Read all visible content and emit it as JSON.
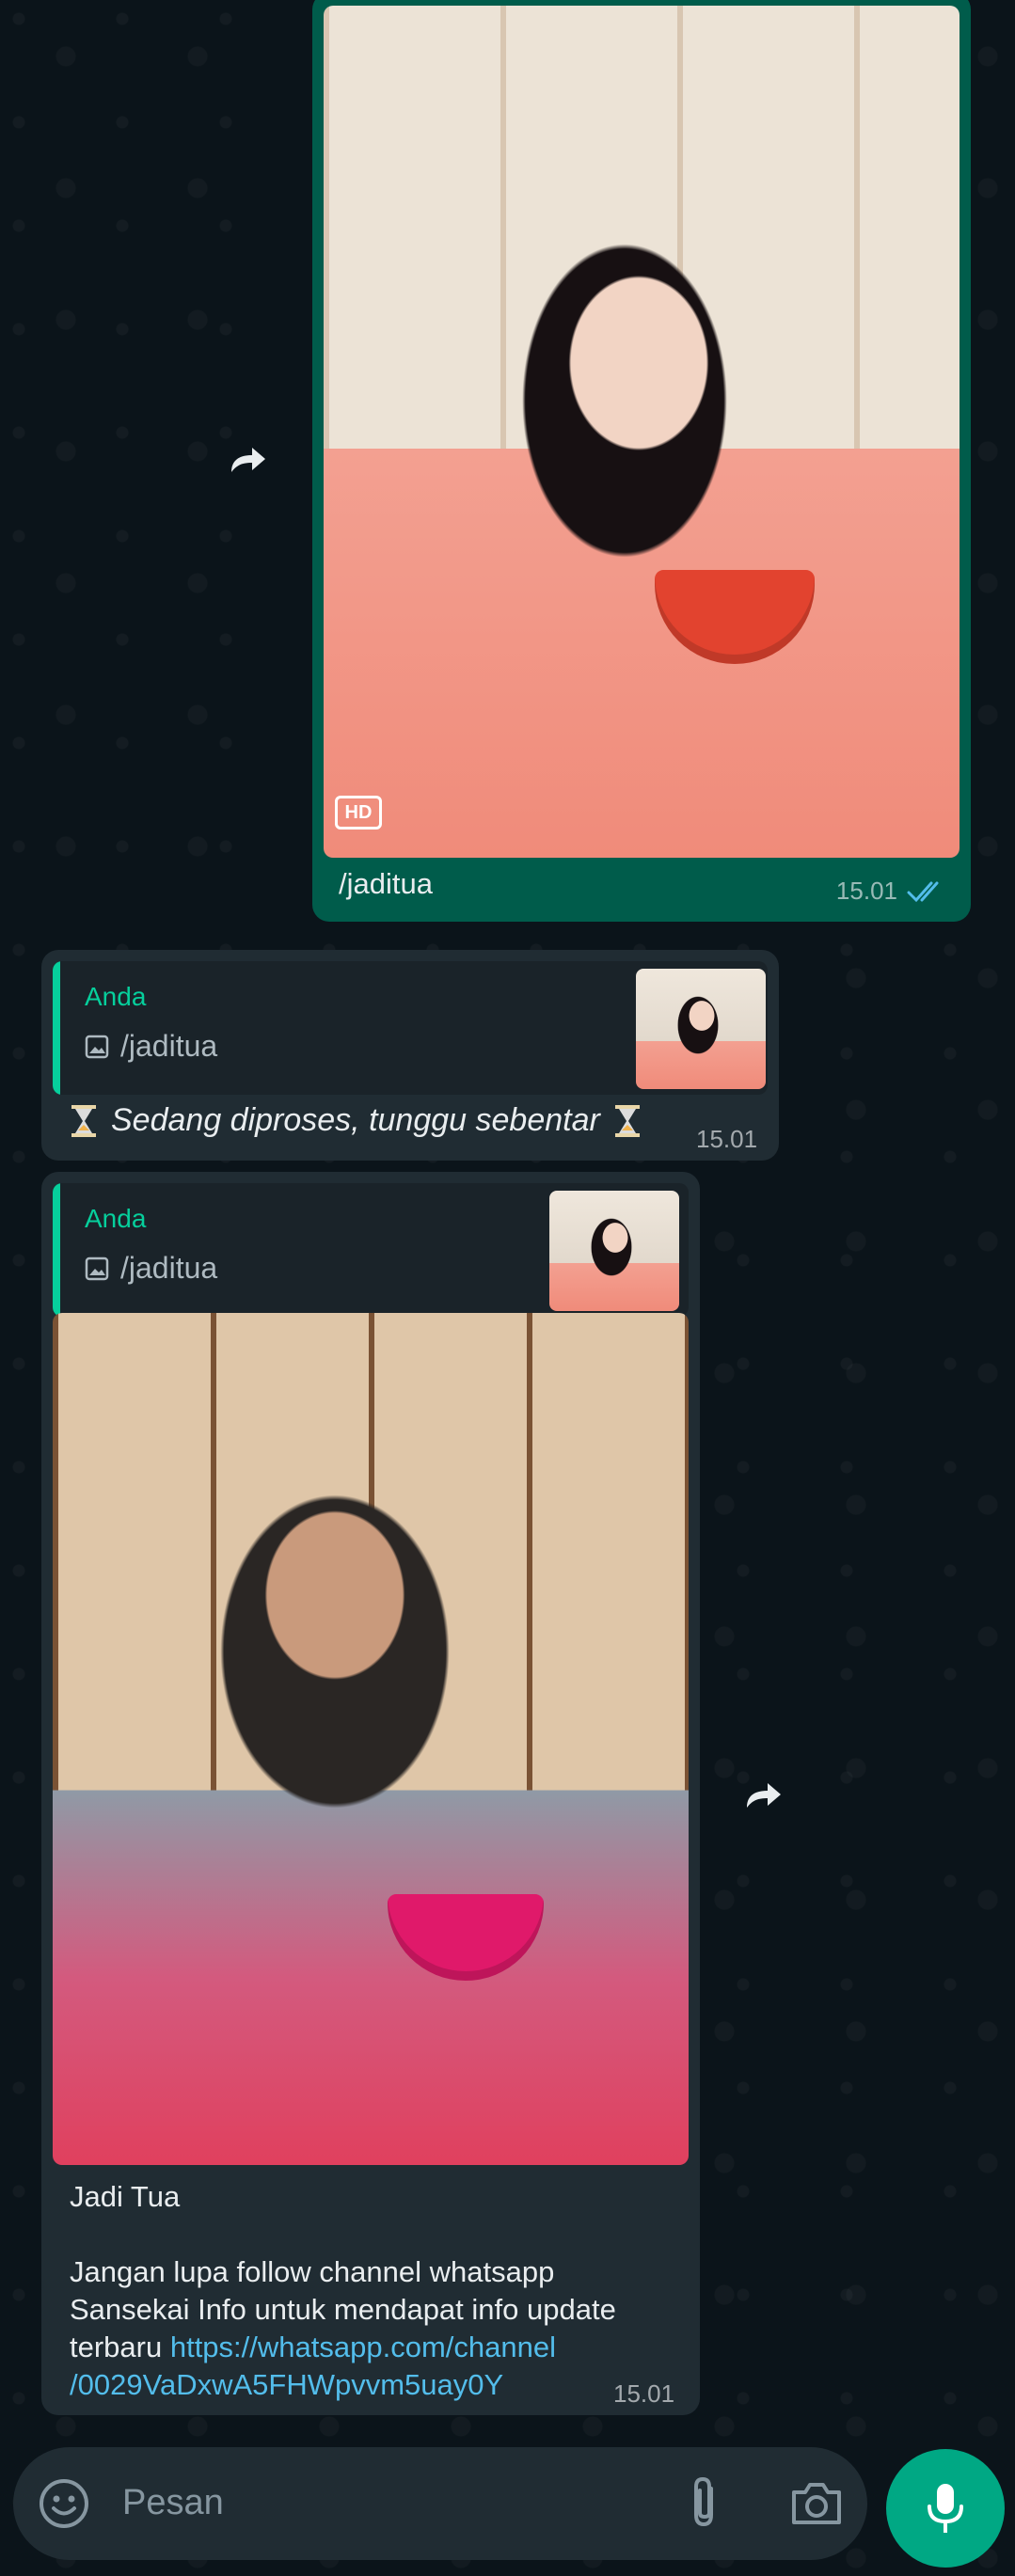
{
  "messages": [
    {
      "caption": "/jaditua",
      "time": "15.01",
      "badge": "HD"
    },
    {
      "quote_name": "Anda",
      "quote_text": "/jaditua",
      "text": "Sedang diproses, tunggu sebentar",
      "time": "15.01"
    },
    {
      "quote_name": "Anda",
      "quote_text": "/jaditua",
      "title": "Jadi Tua",
      "body": "Jangan lupa follow channel whatsapp\nSansekai Info untuk mendapat info update\nterbaru ",
      "link": "https://whatsapp.com/channel\n/0029VaDxwA5FHWpvvm5uay0Y",
      "time": "15.01"
    }
  ],
  "input": {
    "placeholder": "Pesan"
  },
  "icons": {
    "forward": "forward-icon",
    "emoji": "emoji-icon",
    "attach": "paperclip-icon",
    "camera": "camera-icon",
    "mic": "mic-icon",
    "read_receipt": "double-check-icon",
    "image": "image-icon",
    "hourglass": "hourglass-icon"
  },
  "colors": {
    "background": "#0b141a",
    "outgoing_bubble": "#005c4b",
    "incoming_bubble": "#202c33",
    "accent": "#00a884",
    "quote_name": "#06cf9c",
    "link": "#53bdeb",
    "read_check": "#53bdeb"
  }
}
